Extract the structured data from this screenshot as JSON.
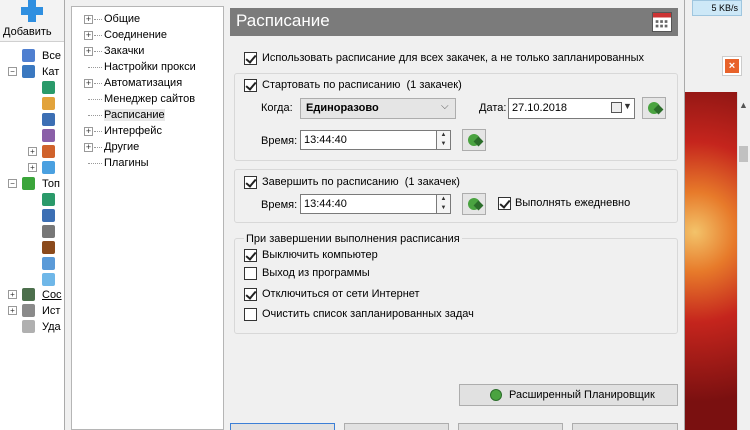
{
  "app": {
    "toolbar": {
      "add_label": "Добавить"
    },
    "tree_labels": [
      "Все",
      "Кат",
      "Топ",
      "Сос",
      "Ист",
      "Уда"
    ],
    "speed": "5 KB/s"
  },
  "dialog": {
    "categories": [
      {
        "label": "Общие",
        "expandable": true
      },
      {
        "label": "Соединение",
        "expandable": true
      },
      {
        "label": "Закачки",
        "expandable": true
      },
      {
        "label": "Настройки прокси",
        "expandable": false
      },
      {
        "label": "Автоматизация",
        "expandable": true
      },
      {
        "label": "Менеджер сайтов",
        "expandable": false
      },
      {
        "label": "Расписание",
        "expandable": false,
        "selected": true
      },
      {
        "label": "Интерфейс",
        "expandable": true
      },
      {
        "label": "Другие",
        "expandable": true
      },
      {
        "label": "Плагины",
        "expandable": false
      }
    ],
    "panel": {
      "title": "Расписание",
      "use_schedule_all": {
        "label": "Использовать расписание для всех закачек, а не только запланированных",
        "checked": true
      },
      "start": {
        "label": "Стартовать по расписанию",
        "count": "(1 закачек)",
        "checked": true,
        "when_label": "Когда:",
        "when_value": "Единоразово",
        "date_label": "Дата:",
        "date_value": "27.10.2018",
        "time_label": "Время:",
        "time_value": "13:44:40"
      },
      "finish": {
        "label": "Завершить по расписанию",
        "count": "(1 закачек)",
        "checked": true,
        "time_label": "Время:",
        "time_value": "13:44:40",
        "daily_label": "Выполнять ежедневно",
        "daily_checked": true
      },
      "on_complete": {
        "title": "При завершении выполнения расписания",
        "options": [
          {
            "label": "Выключить компьютер",
            "checked": true
          },
          {
            "label": "Выход из программы",
            "checked": false
          },
          {
            "label": "Отключиться от сети Интернет",
            "checked": true
          },
          {
            "label": "Очистить список запланированных задач",
            "checked": false
          }
        ]
      },
      "advanced_button": "Расширенный Планировщик"
    }
  }
}
